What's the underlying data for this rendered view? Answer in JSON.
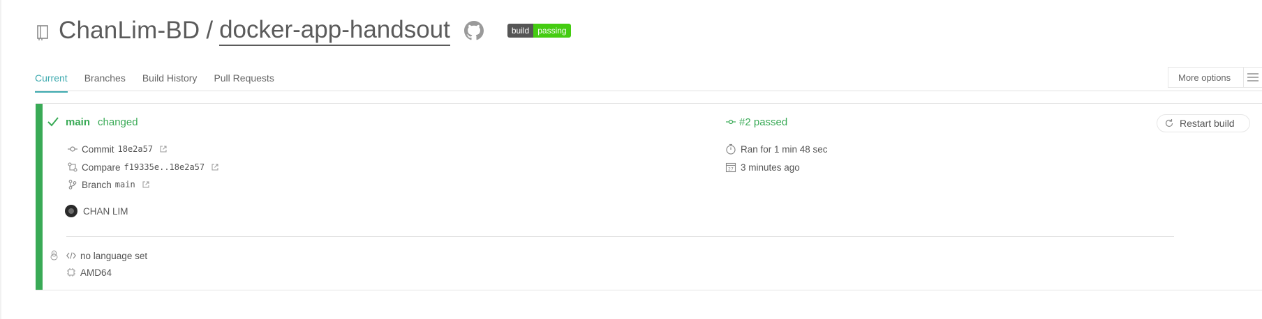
{
  "header": {
    "owner": "ChanLim-BD",
    "separator": "/",
    "repo": "docker-app-handsout",
    "badge": {
      "left": "build",
      "right": "passing",
      "color": "#44cc11"
    }
  },
  "tabs": [
    {
      "label": "Current",
      "active": true
    },
    {
      "label": "Branches",
      "active": false
    },
    {
      "label": "Build History",
      "active": false
    },
    {
      "label": "Pull Requests",
      "active": false
    }
  ],
  "more_options": {
    "label": "More options",
    "icon": "hamburger-menu-icon"
  },
  "build": {
    "status_color": "#39aa56",
    "branch": "main",
    "status_word": "changed",
    "commit": {
      "label": "Commit",
      "hash": "18e2a57"
    },
    "compare": {
      "label": "Compare",
      "range": "f19335e..18e2a57"
    },
    "branch_row": {
      "label": "Branch",
      "name": "main"
    },
    "author": "CHAN LIM",
    "number_status": "#2 passed",
    "duration": "Ran for 1 min 48 sec",
    "finished": "3 minutes ago",
    "restart_label": "Restart build",
    "language": "no language set",
    "arch": "AMD64"
  },
  "colors": {
    "accent": "#3eaaaf",
    "success": "#39aa56"
  }
}
